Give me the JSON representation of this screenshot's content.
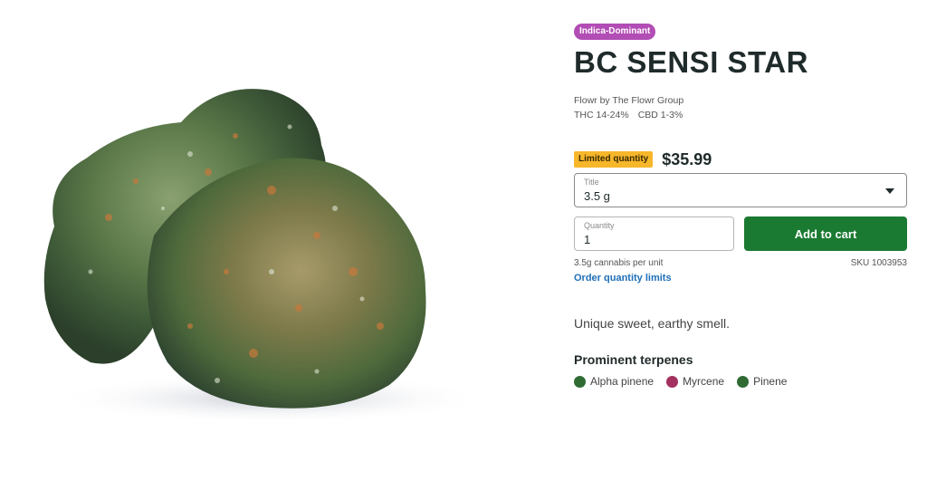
{
  "product": {
    "strain_type": "Indica-Dominant",
    "name": "BC SENSI STAR",
    "brand": "Flowr by The Flowr Group",
    "thc": "THC 14-24%",
    "cbd": "CBD 1-3%",
    "image_alt": "Cannabis flower bud"
  },
  "purchase": {
    "limited_badge": "Limited quantity",
    "price": "$35.99",
    "size_label": "Title",
    "size_value": "3.5 g",
    "quantity_label": "Quantity",
    "quantity_value": "1",
    "add_to_cart": "Add to cart",
    "unit_info": "3.5g cannabis per unit",
    "sku": "SKU 1003953",
    "limits_link": "Order quantity limits"
  },
  "description": "Unique sweet, earthy smell.",
  "terpenes": {
    "heading": "Prominent terpenes",
    "items": [
      {
        "name": "Alpha pinene",
        "color": "#2f6b33"
      },
      {
        "name": "Myrcene",
        "color": "#a3305f"
      },
      {
        "name": "Pinene",
        "color": "#2f6b33"
      }
    ]
  },
  "colors": {
    "strain_badge": "#b24db5",
    "limited_badge": "#f6b72b",
    "add_button": "#1b7a32",
    "link": "#1f6fb8"
  }
}
